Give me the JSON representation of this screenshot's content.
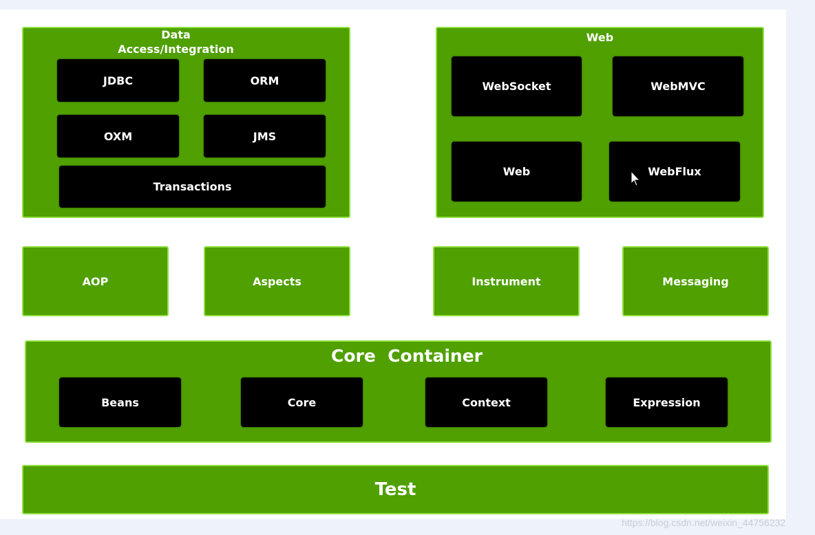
{
  "data_access": {
    "title": "Data Access/Integration",
    "title_line1": "Data",
    "title_line2": "Access/Integration",
    "items": [
      "JDBC",
      "ORM",
      "OXM",
      "JMS",
      "Transactions"
    ]
  },
  "web": {
    "title": "Web",
    "items": [
      "WebSocket",
      "WebMVC",
      "Web",
      "WebFlux"
    ]
  },
  "middle": [
    "AOP",
    "Aspects",
    "Instrument",
    "Messaging"
  ],
  "core_container": {
    "title": "Core  Container",
    "items": [
      "Beans",
      "Core",
      "Context",
      "Expression"
    ]
  },
  "test": "Test",
  "watermark": "https://blog.csdn.net/weixin_44756232",
  "colors": {
    "module_green": "#4fa000",
    "border_green": "#8fe040",
    "submodule": "#000000"
  }
}
